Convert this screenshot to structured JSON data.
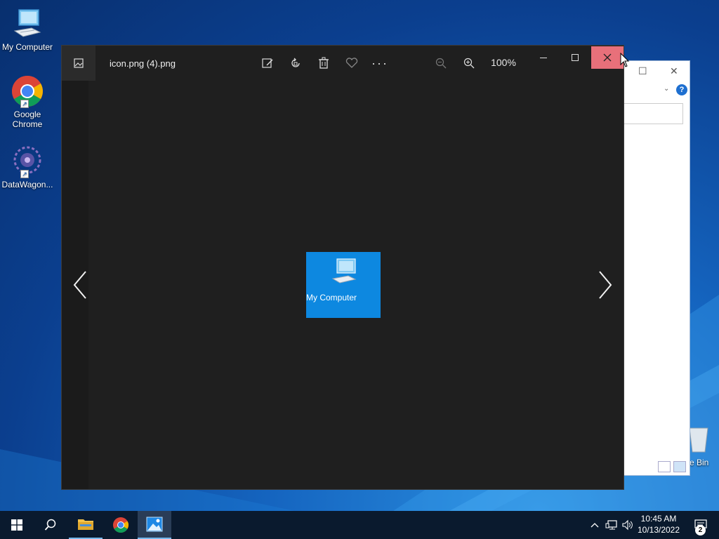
{
  "desktop": {
    "icons": [
      {
        "label": "My Computer"
      },
      {
        "label": "Google Chrome"
      },
      {
        "label": "DataWagon..."
      }
    ],
    "partial_icon_label": "e Bin"
  },
  "viewer": {
    "filename": "icon.png (4).png",
    "zoom": "100%",
    "preview_caption": "My Computer"
  },
  "explorer": {
    "help_label": "?"
  },
  "taskbar": {
    "time": "10:45 AM",
    "date": "10/13/2022",
    "notification_count": "2"
  },
  "colors": {
    "accent": "#0d88e0",
    "close_hover": "#e8707a",
    "viewer_bg": "#1f1f1f",
    "taskbar_bg": "#0a1a2e"
  }
}
